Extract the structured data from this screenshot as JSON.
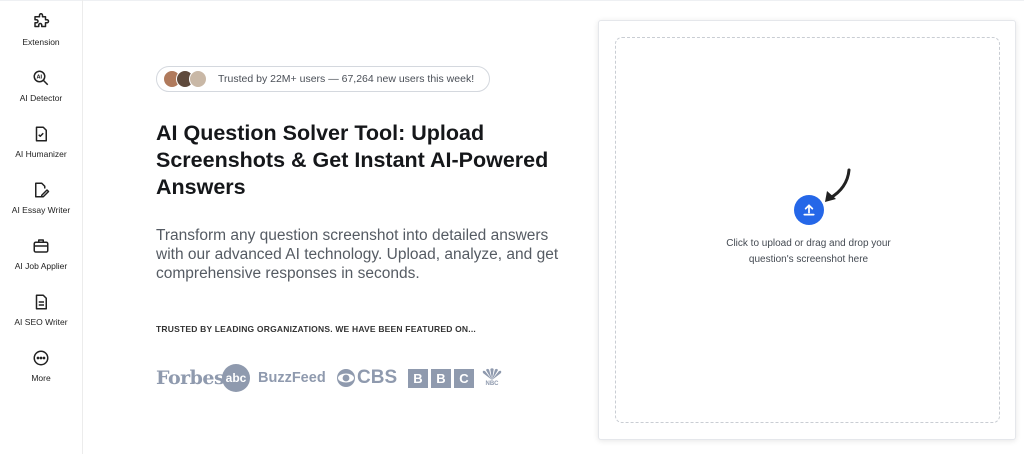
{
  "sidebar": {
    "items": [
      {
        "label": "Extension",
        "icon": "puzzle-icon"
      },
      {
        "label": "AI Detector",
        "icon": "ai-search-icon"
      },
      {
        "label": "AI Humanizer",
        "icon": "document-check-icon"
      },
      {
        "label": "AI Essay Writer",
        "icon": "document-pen-icon"
      },
      {
        "label": "AI Job Applier",
        "icon": "briefcase-icon"
      },
      {
        "label": "AI SEO Writer",
        "icon": "document-lines-icon"
      },
      {
        "label": "More",
        "icon": "more-dots-icon"
      }
    ]
  },
  "hero": {
    "trust_text": "Trusted by 22M+ users — 67,264 new users this week!",
    "title": "AI Question Solver Tool: Upload Screenshots & Get Instant AI-Powered Answers",
    "description": "Transform any question screenshot into detailed answers with our advanced AI technology. Upload, analyze, and get comprehensive responses in seconds.",
    "trusted_by": "TRUSTED BY LEADING ORGANIZATIONS. WE HAVE BEEN FEATURED ON..."
  },
  "logos": {
    "forbes": "Forbes",
    "abc": "abc",
    "buzzfeed": "BuzzFeed",
    "cbs": "CBS",
    "bbc": [
      "B",
      "B",
      "C"
    ],
    "nbc": "NBC"
  },
  "upload": {
    "line1": "Click to upload or drag and drop your",
    "line2": "question's screenshot here"
  },
  "colors": {
    "accent": "#2567e8",
    "logo_gray": "#8f9aae"
  }
}
